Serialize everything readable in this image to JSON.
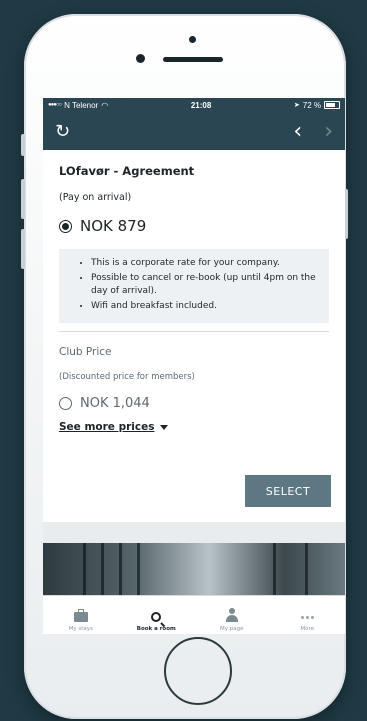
{
  "statusbar": {
    "carrier": "N Telenor",
    "time": "21:08",
    "battery": "72 %"
  },
  "nav": {
    "refresh_icon": "refresh-icon",
    "back_icon": "chevron-left-icon",
    "forward_icon": "chevron-right-icon"
  },
  "rate": {
    "title": "LOfavør - Agreement",
    "subtitle": "(Pay on arrival)",
    "price": "NOK 879",
    "benefits": [
      "This is a corporate rate for your company.",
      "Possible to cancel or re-book (up until 4pm on the day of arrival).",
      "Wifi and breakfast included."
    ]
  },
  "club": {
    "title": "Club Price",
    "subtitle": "(Discounted price for members)",
    "price": "NOK 1,044"
  },
  "actions": {
    "see_more": "See more prices",
    "select": "SELECT"
  },
  "tabs": [
    {
      "label": "My stays",
      "icon": "briefcase-icon"
    },
    {
      "label": "Book a room",
      "icon": "search-icon"
    },
    {
      "label": "My page",
      "icon": "user-icon"
    },
    {
      "label": "More",
      "icon": "more-dots-icon"
    }
  ],
  "colors": {
    "background": "#1f3a44",
    "header": "#2b4653",
    "button": "#5d7883"
  }
}
